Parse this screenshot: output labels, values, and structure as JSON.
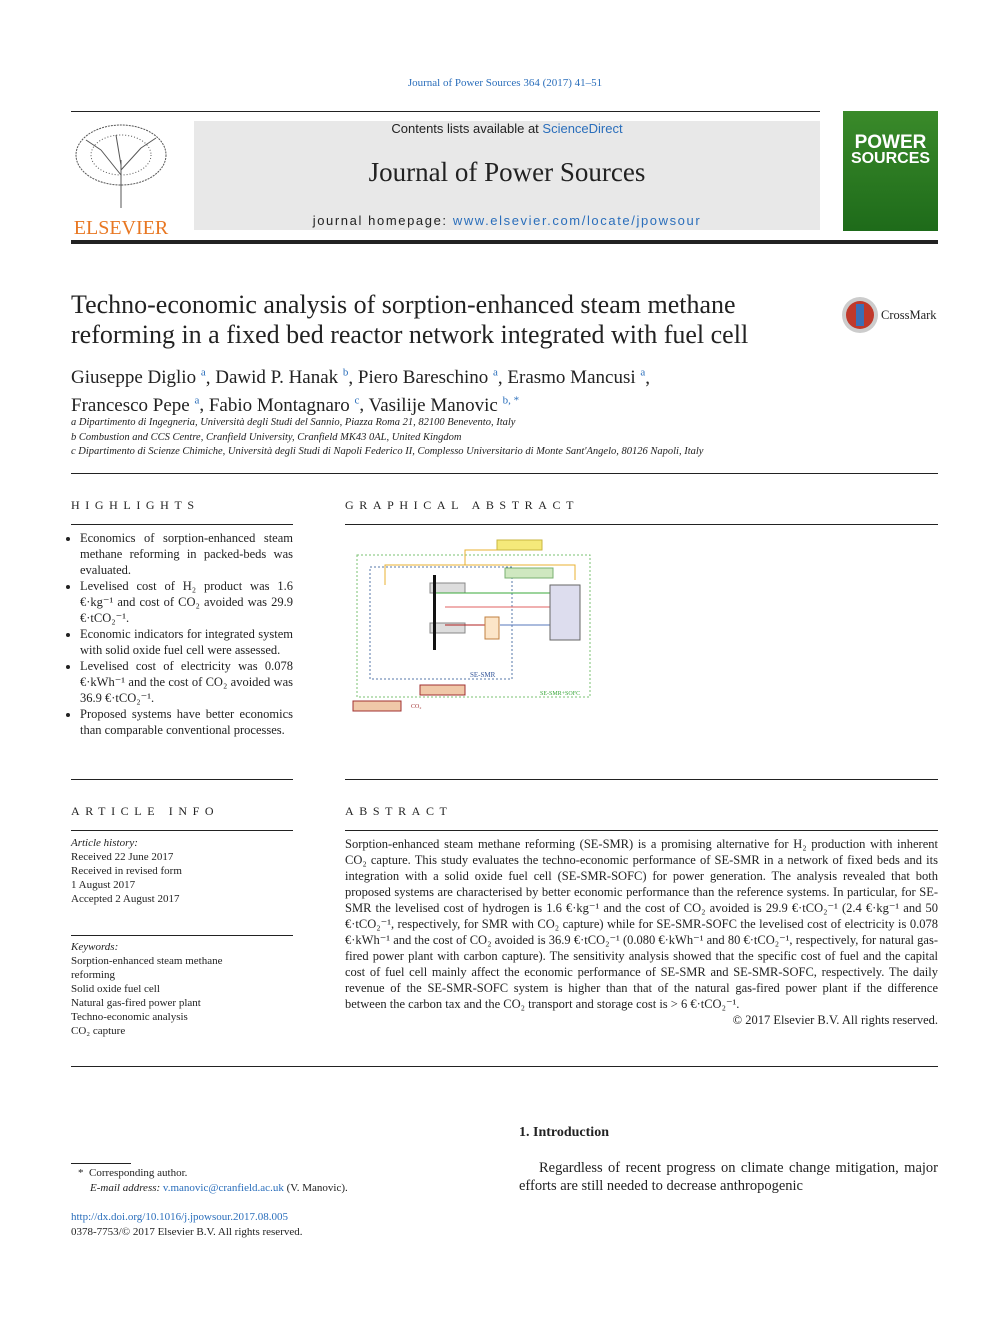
{
  "journal_ref": "Journal of Power Sources 364 (2017) 41–51",
  "banner": {
    "contents_prefix": "Contents lists available at ",
    "contents_link": "ScienceDirect",
    "journal_name": "Journal of Power Sources",
    "homepage_prefix": "journal homepage: ",
    "homepage_link": "www.elsevier.com/locate/jpowsour"
  },
  "publisher_logo": "ELSEVIER",
  "cover": {
    "title_line1": "POWER",
    "title_line2": "SOURCES"
  },
  "crossmark": "CrossMark",
  "title": "Techno-economic analysis of sorption-enhanced steam methane reforming in a fixed bed reactor network integrated with fuel cell",
  "authors": [
    {
      "name": "Giuseppe Diglio",
      "sup": "a"
    },
    {
      "name": "Dawid P. Hanak",
      "sup": "b"
    },
    {
      "name": "Piero Bareschino",
      "sup": "a"
    },
    {
      "name": "Erasmo Mancusi",
      "sup": "a"
    },
    {
      "name": "Francesco Pepe",
      "sup": "a"
    },
    {
      "name": "Fabio Montagnaro",
      "sup": "c"
    },
    {
      "name": "Vasilije Manovic",
      "sup": "b, *"
    }
  ],
  "affiliations": [
    "a Dipartimento di Ingegneria, Università degli Studi del Sannio, Piazza Roma 21, 82100 Benevento, Italy",
    "b Combustion and CCS Centre, Cranfield University, Cranfield MK43 0AL, United Kingdom",
    "c Dipartimento di Scienze Chimiche, Università degli Studi di Napoli Federico II, Complesso Universitario di Monte Sant'Angelo, 80126 Napoli, Italy"
  ],
  "highlights": {
    "heading": "HIGHLIGHTS",
    "items": [
      "Economics of sorption-enhanced steam methane reforming in packed-beds was evaluated.",
      "Levelised cost of H₂ product was 1.6 €·kg⁻¹ and cost of CO₂ avoided was 29.9 €·tCO₂⁻¹.",
      "Economic indicators for integrated system with solid oxide fuel cell were assessed.",
      "Levelised cost of electricity was 0.078 €·kWh⁻¹ and the cost of CO₂ avoided was 36.9 €·tCO₂⁻¹.",
      "Proposed systems have better economics than comparable conventional processes."
    ]
  },
  "graphical_abstract": {
    "heading": "GRAPHICAL ABSTRACT",
    "labels": {
      "inner": "SE-SMR",
      "outer": "SE-SMR+SOFC",
      "co2": "CO₂"
    }
  },
  "article_info": {
    "heading": "ARTICLE INFO",
    "history_label": "Article history:",
    "history": [
      "Received 22 June 2017",
      "Received in revised form",
      "1 August 2017",
      "Accepted 2 August 2017"
    ],
    "keywords_label": "Keywords:",
    "keywords": [
      "Sorption-enhanced steam methane",
      "reforming",
      "Solid oxide fuel cell",
      "Natural gas-fired power plant",
      "Techno-economic analysis",
      "CO₂ capture"
    ]
  },
  "abstract": {
    "heading": "ABSTRACT",
    "text": "Sorption-enhanced steam methane reforming (SE-SMR) is a promising alternative for H₂ production with inherent CO₂ capture. This study evaluates the techno-economic performance of SE-SMR in a network of fixed beds and its integration with a solid oxide fuel cell (SE-SMR-SOFC) for power generation. The analysis revealed that both proposed systems are characterised by better economic performance than the reference systems. In particular, for SE-SMR the levelised cost of hydrogen is 1.6 €·kg⁻¹ and the cost of CO₂ avoided is 29.9 €·tCO₂⁻¹ (2.4 €·kg⁻¹ and 50 €·tCO₂⁻¹, respectively, for SMR with CO₂ capture) while for SE-SMR-SOFC the levelised cost of electricity is 0.078 €·kWh⁻¹ and the cost of CO₂ avoided is 36.9 €·tCO₂⁻¹ (0.080 €·kWh⁻¹ and 80 €·tCO₂⁻¹, respectively, for natural gas-fired power plant with carbon capture). The sensitivity analysis showed that the specific cost of fuel and the capital cost of fuel cell mainly affect the economic performance of SE-SMR and SE-SMR-SOFC, respectively. The daily revenue of the SE-SMR-SOFC system is higher than that of the natural gas-fired power plant if the difference between the carbon tax and the CO₂ transport and storage cost is > 6 €·tCO₂⁻¹.",
    "copyright": "© 2017 Elsevier B.V. All rights reserved."
  },
  "footnote": {
    "marker": "*",
    "corresponding": "Corresponding author.",
    "email_label": "E-mail address: ",
    "email": "v.manovic@cranfield.ac.uk",
    "email_suffix": " (V. Manovic)."
  },
  "doi": "http://dx.doi.org/10.1016/j.jpowsour.2017.08.005",
  "issn": "0378-7753/© 2017 Elsevier B.V. All rights reserved.",
  "intro": {
    "heading": "1.  Introduction",
    "text": "Regardless of recent progress on climate change mitigation, major efforts are still needed to decrease anthropogenic"
  }
}
